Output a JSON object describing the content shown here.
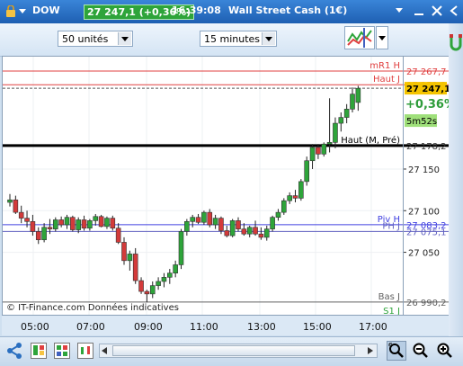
{
  "title_bar": {
    "symbol": "DOW",
    "price_change": "27 247,1 (+0,36%)",
    "time": "16:39:08",
    "instrument": "Wall Street Cash (1€)"
  },
  "toolbar": {
    "units_select": "50 unités",
    "interval_select": "15 minutes"
  },
  "chart": {
    "watermark": "© IT-Finance.com Données indicatives",
    "time_labels": [
      "05:00",
      "07:00",
      "09:00",
      "11:00",
      "13:00",
      "15:00",
      "17:00"
    ],
    "price_ticks": [
      "27 150",
      "27 100",
      "27 050"
    ],
    "levels": [
      {
        "name": "mR1 H",
        "value": "27 267,7",
        "color": "#e04040"
      },
      {
        "name": "Haut J",
        "value": "27 251,3",
        "color": "#e04040"
      },
      {
        "name": "Haut (M, Pré)",
        "value": "27 178,2",
        "color": "#000000"
      },
      {
        "name": "Piv H",
        "value": "27 083,2",
        "color": "#4040e0"
      },
      {
        "name": "PH J",
        "value": "27 075,1",
        "color": "#6060c0"
      },
      {
        "name": "Bas J",
        "value": "26 990,2",
        "color": "#606060"
      },
      {
        "name": "S1 J",
        "value": "",
        "color": "#2ea43a"
      }
    ],
    "current_price": "27 247,1",
    "current_change": "+0,36%",
    "countdown": "5m52s",
    "candles": [
      [
        27110,
        27120,
        27105,
        27113
      ],
      [
        27113,
        27118,
        27096,
        27098
      ],
      [
        27098,
        27106,
        27085,
        27091
      ],
      [
        27091,
        27100,
        27080,
        27087
      ],
      [
        27087,
        27095,
        27070,
        27075
      ],
      [
        27075,
        27080,
        27060,
        27065
      ],
      [
        27065,
        27085,
        27062,
        27080
      ],
      [
        27080,
        27090,
        27072,
        27078
      ],
      [
        27078,
        27092,
        27075,
        27089
      ],
      [
        27089,
        27093,
        27080,
        27083
      ],
      [
        27083,
        27095,
        27078,
        27092
      ],
      [
        27092,
        27094,
        27075,
        27077
      ],
      [
        27077,
        27092,
        27073,
        27089
      ],
      [
        27089,
        27094,
        27076,
        27079
      ],
      [
        27079,
        27090,
        27076,
        27088
      ],
      [
        27088,
        27096,
        27082,
        27093
      ],
      [
        27093,
        27095,
        27080,
        27081
      ],
      [
        27081,
        27093,
        27078,
        27091
      ],
      [
        27091,
        27094,
        27076,
        27079
      ],
      [
        27079,
        27085,
        27060,
        27062
      ],
      [
        27062,
        27068,
        27035,
        27040
      ],
      [
        27040,
        27052,
        27028,
        27048
      ],
      [
        27048,
        27055,
        27012,
        27016
      ],
      [
        27016,
        27020,
        27000,
        27003
      ],
      [
        27003,
        27005,
        26990,
        27000
      ],
      [
        27000,
        27015,
        26995,
        27010
      ],
      [
        27010,
        27020,
        27005,
        27015
      ],
      [
        27015,
        27025,
        27008,
        27020
      ],
      [
        27020,
        27030,
        27012,
        27025
      ],
      [
        27025,
        27040,
        27020,
        27035
      ],
      [
        27035,
        27078,
        27030,
        27075
      ],
      [
        27075,
        27090,
        27070,
        27087
      ],
      [
        27087,
        27095,
        27080,
        27092
      ],
      [
        27092,
        27096,
        27084,
        27086
      ],
      [
        27086,
        27100,
        27083,
        27098
      ],
      [
        27098,
        27102,
        27080,
        27083
      ],
      [
        27083,
        27095,
        27078,
        27091
      ],
      [
        27091,
        27093,
        27072,
        27076
      ],
      [
        27076,
        27082,
        27068,
        27070
      ],
      [
        27070,
        27090,
        27068,
        27088
      ],
      [
        27088,
        27092,
        27075,
        27078
      ],
      [
        27078,
        27085,
        27070,
        27072
      ],
      [
        27072,
        27082,
        27068,
        27080
      ],
      [
        27080,
        27088,
        27070,
        27072
      ],
      [
        27072,
        27080,
        27065,
        27068
      ],
      [
        27068,
        27082,
        27064,
        27078
      ],
      [
        27078,
        27094,
        27075,
        27092
      ],
      [
        27092,
        27102,
        27088,
        27098
      ],
      [
        27098,
        27115,
        27095,
        27112
      ],
      [
        27112,
        27122,
        27108,
        27118
      ],
      [
        27118,
        27125,
        27110,
        27115
      ],
      [
        27115,
        27138,
        27112,
        27135
      ],
      [
        27135,
        27165,
        27130,
        27160
      ],
      [
        27160,
        27180,
        27150,
        27176
      ],
      [
        27176,
        27180,
        27162,
        27168
      ],
      [
        27168,
        27182,
        27165,
        27180
      ],
      [
        27180,
        27235,
        27170,
        27182
      ],
      [
        27182,
        27212,
        27175,
        27205
      ],
      [
        27205,
        27218,
        27195,
        27212
      ],
      [
        27212,
        27228,
        27205,
        27222
      ],
      [
        27222,
        27248,
        27218,
        27240
      ],
      [
        27230,
        27250,
        27220,
        27247
      ]
    ]
  },
  "chart_data": {
    "type": "candlestick",
    "xlabel": "",
    "ylabel": "",
    "ylim": [
      26975,
      27285
    ],
    "x_ticks": [
      "05:00",
      "07:00",
      "09:00",
      "11:00",
      "13:00",
      "15:00",
      "17:00"
    ],
    "y_ticks": [
      "27 150",
      "27 100",
      "27 050"
    ]
  }
}
